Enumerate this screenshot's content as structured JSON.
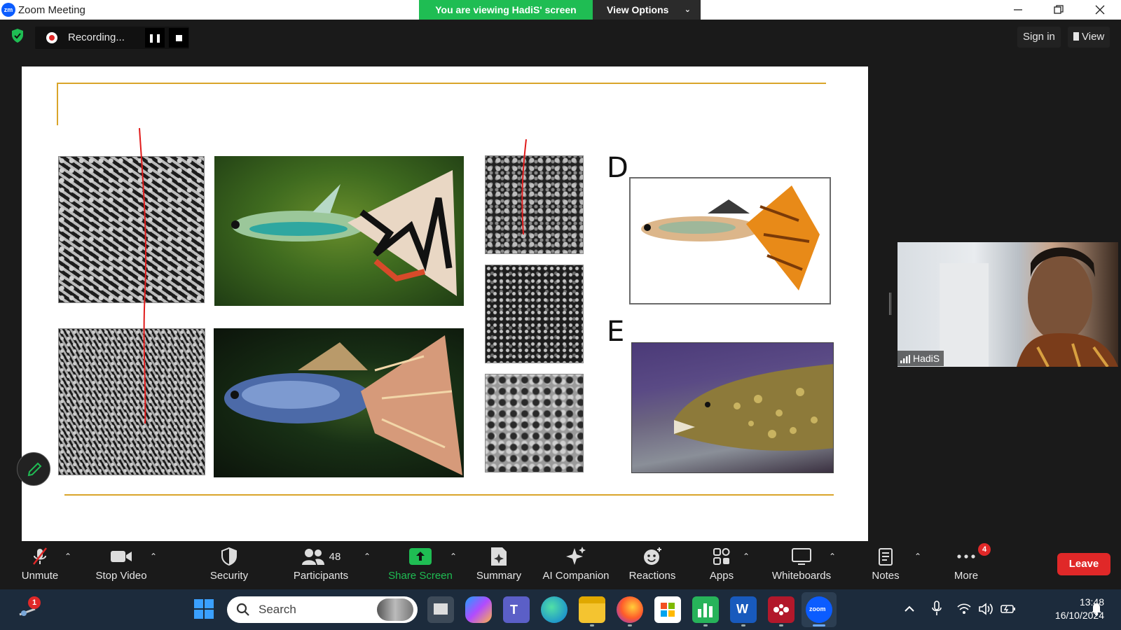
{
  "window": {
    "title": "Zoom Meeting",
    "logo_text": "zm",
    "viewing_banner": "You are viewing HadiS' screen",
    "view_options_label": "View Options"
  },
  "recording": {
    "status_text": "Recording...",
    "pause_icon": "pause-icon",
    "stop_icon": "stop-icon"
  },
  "topbar": {
    "sign_in_label": "Sign in",
    "view_label": "View",
    "security_icon": "shield-check-icon"
  },
  "slide": {
    "panel_labels": [
      "D",
      "E"
    ],
    "accent_color": "#d9a52a",
    "annotation_color": "#e01b1b"
  },
  "participant": {
    "name": "HadiS"
  },
  "toolbar": {
    "items": [
      {
        "label": "Unmute",
        "icon": "mic-muted-icon"
      },
      {
        "label": "Stop Video",
        "icon": "video-camera-icon"
      },
      {
        "label": "Security",
        "icon": "shield-icon"
      },
      {
        "label": "Participants",
        "icon": "participants-icon",
        "count": "48"
      },
      {
        "label": "Share Screen",
        "icon": "share-screen-icon"
      },
      {
        "label": "Summary",
        "icon": "summary-icon"
      },
      {
        "label": "AI Companion",
        "icon": "sparkle-icon"
      },
      {
        "label": "Reactions",
        "icon": "reactions-icon"
      },
      {
        "label": "Apps",
        "icon": "apps-icon"
      },
      {
        "label": "Whiteboards",
        "icon": "whiteboard-icon"
      },
      {
        "label": "Notes",
        "icon": "notes-icon"
      },
      {
        "label": "More",
        "icon": "more-icon",
        "badge": "4"
      }
    ],
    "leave_label": "Leave",
    "share_color": "#1fbd53",
    "leave_color": "#e02828"
  },
  "taskbar": {
    "search_placeholder": "Search",
    "notification_badge": "1",
    "time": "13:48",
    "date": "16/10/2024",
    "apps": [
      "windows-start-icon",
      "task-view-icon",
      "copilot-icon",
      "teams-icon",
      "edge-icon",
      "file-explorer-icon",
      "firefox-icon",
      "store-icon",
      "chart-app-icon",
      "word-icon",
      "mendeley-icon",
      "zoom-icon"
    ]
  }
}
